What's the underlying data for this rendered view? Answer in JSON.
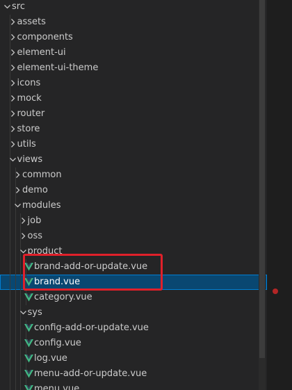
{
  "explorer": {
    "items": [
      {
        "label": "src",
        "depth": 0,
        "type": "folder",
        "expanded": true
      },
      {
        "label": "assets",
        "depth": 1,
        "type": "folder",
        "expanded": false
      },
      {
        "label": "components",
        "depth": 1,
        "type": "folder",
        "expanded": false
      },
      {
        "label": "element-ui",
        "depth": 1,
        "type": "folder",
        "expanded": false
      },
      {
        "label": "element-ui-theme",
        "depth": 1,
        "type": "folder",
        "expanded": false
      },
      {
        "label": "icons",
        "depth": 1,
        "type": "folder",
        "expanded": false
      },
      {
        "label": "mock",
        "depth": 1,
        "type": "folder",
        "expanded": false
      },
      {
        "label": "router",
        "depth": 1,
        "type": "folder",
        "expanded": false
      },
      {
        "label": "store",
        "depth": 1,
        "type": "folder",
        "expanded": false
      },
      {
        "label": "utils",
        "depth": 1,
        "type": "folder",
        "expanded": false
      },
      {
        "label": "views",
        "depth": 1,
        "type": "folder",
        "expanded": true
      },
      {
        "label": "common",
        "depth": 2,
        "type": "folder",
        "expanded": false
      },
      {
        "label": "demo",
        "depth": 2,
        "type": "folder",
        "expanded": false
      },
      {
        "label": "modules",
        "depth": 2,
        "type": "folder",
        "expanded": true
      },
      {
        "label": "job",
        "depth": 3,
        "type": "folder",
        "expanded": false
      },
      {
        "label": "oss",
        "depth": 3,
        "type": "folder",
        "expanded": false
      },
      {
        "label": "product",
        "depth": 3,
        "type": "folder",
        "expanded": true
      },
      {
        "label": "brand-add-or-update.vue",
        "depth": 4,
        "type": "vue"
      },
      {
        "label": "brand.vue",
        "depth": 4,
        "type": "vue",
        "selected": true
      },
      {
        "label": "category.vue",
        "depth": 4,
        "type": "vue"
      },
      {
        "label": "sys",
        "depth": 3,
        "type": "folder",
        "expanded": true
      },
      {
        "label": "config-add-or-update.vue",
        "depth": 4,
        "type": "vue"
      },
      {
        "label": "config.vue",
        "depth": 4,
        "type": "vue"
      },
      {
        "label": "log.vue",
        "depth": 4,
        "type": "vue"
      },
      {
        "label": "menu-add-or-update.vue",
        "depth": 4,
        "type": "vue"
      },
      {
        "label": "menu.vue",
        "depth": 4,
        "type": "vue"
      }
    ]
  },
  "colors": {
    "vue_icon": "#41b883",
    "selection": "#094771",
    "annotation": "#e0202a",
    "breakpoint": "#b32626"
  },
  "icons": {
    "folder_collapsed": "chevron-right-icon",
    "folder_expanded": "chevron-down-icon",
    "vue_file": "vue-file-icon"
  }
}
